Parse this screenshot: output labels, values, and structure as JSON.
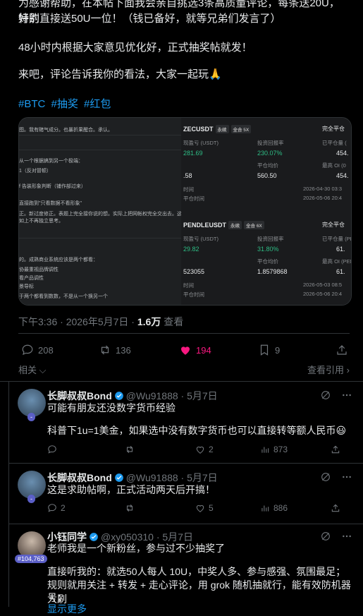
{
  "post": {
    "line1": "为感谢帮助，在本帖下面我会亲自挑选3条高质量评论，每条送20U，特别",
    "line2": "好的直接送50U一位！（钱已备好，就等兄弟们发言了）",
    "line3": "48小时内根据大家意见优化好，正式抽奖帖就发！",
    "line4": "来吧，评论告诉我你的看法，大家一起玩🙏",
    "hashtags": [
      "#BTC",
      "#抽奖",
      "#红包"
    ],
    "time": "下午3:36 · 2026年5月7日 · ",
    "views_count": "1.6万",
    "views_label": " 查看"
  },
  "media": {
    "left_lines": [
      "图。我有赌气成分。也暴折果醒合。承认。",
      "从一个根据搞到另一个极端：",
      "1（反对冒顿）",
      "f 告装形象判断（铺作部过来）",
      "直接跑到\"只看数据不看形象\"",
      "正。新过度修正。表题上完全接你说的想。实际上把网帐权完全交出去。这本身就",
      "如上不再独立思考。",
      "的。成熟商业系统应该是两个都看：",
      "协最重视品牌调性",
      "看产品调性",
      "景导标",
      "于两个都看到数数，不是从一个换另一个"
    ],
    "cards": [
      {
        "symbol": "ZECUSDT",
        "perp": "永续",
        "margin": "全合 5X",
        "status": "完全平仓",
        "pnl_label": "现盈亏 (USDT)",
        "pnl": "281.69",
        "roi_label": "投资回报率",
        "roi": "230.07%",
        "closed_label": "已平仓量 (",
        "closed": "454.",
        "entry_label": "开仓均价",
        "entry": ".58",
        "exit_label": "平仓均价",
        "exit": "560.50",
        "maxoi_label": "最高 OI (0",
        "maxoi": "454.",
        "t1_label": "时间",
        "t1": "2026-04-30 03:3",
        "t2_label": "平仓时间",
        "t2": "2026-05-06 20:4"
      },
      {
        "symbol": "PENDLEUSDT",
        "perp": "永续",
        "margin": "全合 6X",
        "status": "完全平仓",
        "pnl_label": "现盈亏 (USDT)",
        "pnl": "29.82",
        "roi_label": "投资回报率",
        "roi": "31.80%",
        "closed_label": "已平仓量 (PEN",
        "closed": "61.",
        "entry_label": "开仓均价",
        "entry": "523055",
        "exit_label": "平仓均价",
        "exit": "1.8579868",
        "maxoi_label": "最高 OI (PEN",
        "maxoi": "61.",
        "t1_label": "时间",
        "t1": "2026-05-03 08:5",
        "t2_label": "平仓时间",
        "t2": "2026-05-06 20:4"
      }
    ]
  },
  "actions": {
    "replies": "208",
    "reposts": "136",
    "likes": "194",
    "bookmarks": "9",
    "related": "相关",
    "quotes": "查看引用"
  },
  "colors": {
    "accent": "#1d9bf0",
    "like": "#f91880",
    "profit": "#2ebd85",
    "muted": "#71767b"
  },
  "replies": [
    {
      "name": "长脚叔叔Bond",
      "handle": "@Wu91888 · 5月7日",
      "text1": "可能有朋友还没数字货币经验",
      "text2": "科普下1u=1美金，如果选中没有数字货币也可以直接转等额人民币😃",
      "badge": "-",
      "likes": "2",
      "views": "873"
    },
    {
      "name": "长脚叔叔Bond",
      "handle": "@Wu91888 · 5月7日",
      "text1": "这是求助帖啊，正式活动两天后开搞！",
      "badge": "-",
      "replies": "2",
      "likes": "5",
      "views": "886"
    },
    {
      "name": "小钰同学",
      "handle": "@xy050310 · 5月7日",
      "text1": "老师我是一个新粉丝，参与过不少抽奖了",
      "text2": "直接听我的：就选50人每人 10U，中奖人多、参与感强、氛围最足；",
      "text3": "规则就用关注 + 转发 + 走心评论，用 grok 随机抽就行，能有效防机器人刷",
      "text4": "号；",
      "more": "显示更多",
      "badge": "#104,763"
    }
  ]
}
